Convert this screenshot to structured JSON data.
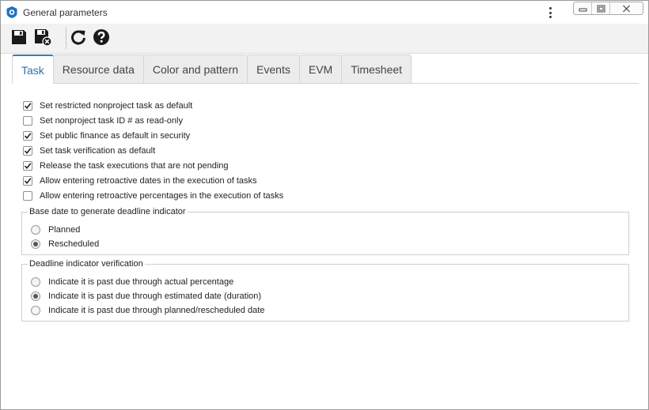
{
  "window": {
    "title": "General parameters"
  },
  "icons": {
    "app": "app-logo-icon",
    "menu": "kebab-menu-icon",
    "minimize": "minimize-icon",
    "restore": "restore-icon",
    "close": "close-icon",
    "save": "save-icon",
    "save_close": "save-and-close-icon",
    "refresh": "refresh-icon",
    "help": "help-icon"
  },
  "tabs": [
    {
      "label": "Task",
      "active": true
    },
    {
      "label": "Resource data",
      "active": false
    },
    {
      "label": "Color and pattern",
      "active": false
    },
    {
      "label": "Events",
      "active": false
    },
    {
      "label": "EVM",
      "active": false
    },
    {
      "label": "Timesheet",
      "active": false
    }
  ],
  "options": [
    {
      "label": "Set restricted nonproject task as default",
      "checked": true
    },
    {
      "label": "Set nonproject task ID # as read-only",
      "checked": false
    },
    {
      "label": "Set public finance as default in security",
      "checked": true
    },
    {
      "label": "Set task verification as default",
      "checked": true
    },
    {
      "label": "Release the task executions that are not pending",
      "checked": true
    },
    {
      "label": "Allow entering retroactive dates in the execution of tasks",
      "checked": true
    },
    {
      "label": "Allow entering retroactive percentages in the execution of tasks",
      "checked": false
    }
  ],
  "base_date": {
    "legend": "Base date to generate deadline indicator",
    "options": [
      {
        "label": "Planned",
        "selected": false
      },
      {
        "label": "Rescheduled",
        "selected": true
      }
    ]
  },
  "deadline": {
    "legend": "Deadline indicator verification",
    "options": [
      {
        "label": "Indicate it is past due through actual percentage",
        "selected": false
      },
      {
        "label": "Indicate it is past due through estimated date (duration)",
        "selected": true
      },
      {
        "label": "Indicate it is past due through planned/rescheduled date",
        "selected": false
      }
    ]
  },
  "colors": {
    "accent": "#2f6fb0",
    "toolbar_bg": "#f2f2f2"
  }
}
